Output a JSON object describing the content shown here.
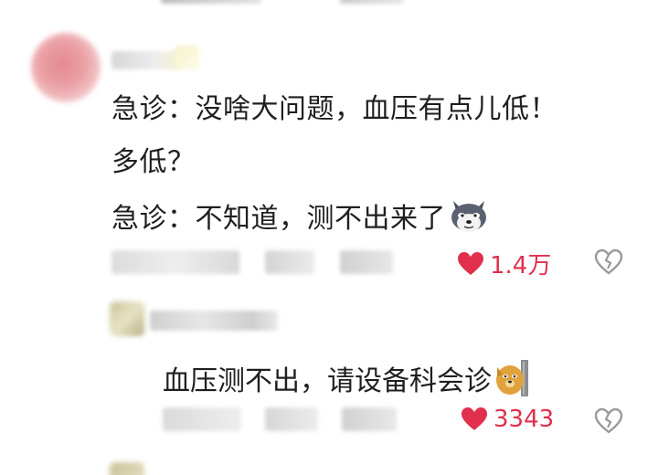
{
  "comment": {
    "lines": [
      "急诊：没啥大问题，血压有点儿低！",
      "多低？",
      "急诊：不知道，测不出来了"
    ],
    "emoji": "wolf-face-emoji",
    "likes": "1.4万"
  },
  "reply": {
    "text": "血压测不出，请设备科会诊",
    "emoji": "dog-peeking-emoji",
    "likes": "3343"
  },
  "colors": {
    "like_red": "#e0304d",
    "text": "#1f1f1f",
    "icon_gray": "#9a9a9a"
  }
}
